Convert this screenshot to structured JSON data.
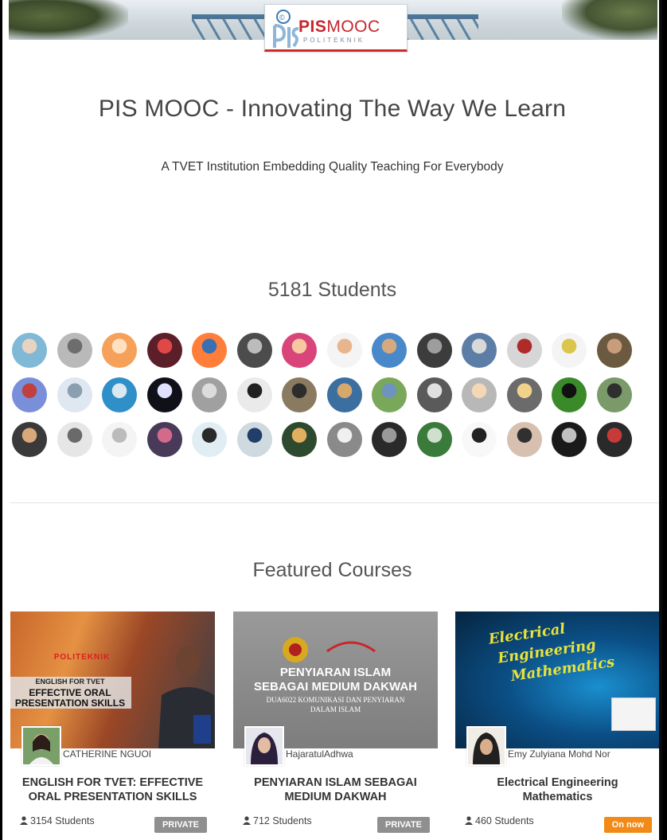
{
  "brand": {
    "logo_initials": "PIS",
    "logo_word_bold": "PIS",
    "logo_word": "MOOC",
    "logo_sub": "POLITEKNIK"
  },
  "hero": {
    "title": "PIS MOOC - Innovating The Way We Learn",
    "subtitle": "A TVET Institution Embedding Quality Teaching For Everybody"
  },
  "students": {
    "heading": "5181 Students",
    "avatar_count": 42
  },
  "featured": {
    "heading": "Featured Courses",
    "courses": [
      {
        "image_lines": [
          "POLITEKNIK",
          "ENGLISH FOR TVET",
          "EFFECTIVE ORAL",
          "PRESENTATION SKILLS"
        ],
        "author": "CATHERINE NGUOI",
        "title": "ENGLISH FOR TVET: EFFECTIVE ORAL PRESENTATION SKILLS",
        "students": "3154 Students",
        "badge": "PRIVATE",
        "badge_color": "#8f8f8f"
      },
      {
        "image_lines": [
          "PENYIARAN ISLAM",
          "SEBAGAI MEDIUM DAKWAH",
          "DUA6022 KOMUNIKASI DAN PENYIARAN",
          "DALAM ISLAM"
        ],
        "author": "HajaratulAdhwa",
        "title": "PENYIARAN ISLAM SEBAGAI MEDIUM DAKWAH",
        "students": "712 Students",
        "badge": "PRIVATE",
        "badge_color": "#8f8f8f"
      },
      {
        "image_lines": [
          "Electrical",
          "Engineering",
          "Mathematics"
        ],
        "author": "Emy Zulyiana Mohd Nor",
        "title": "Electrical Engineering Mathematics",
        "students": "460 Students",
        "badge": "On now",
        "badge_color": "#f28a18"
      }
    ]
  },
  "colors": {
    "brand_red": "#c6262b",
    "badge_private": "#8f8f8f",
    "badge_live": "#f28a18"
  }
}
